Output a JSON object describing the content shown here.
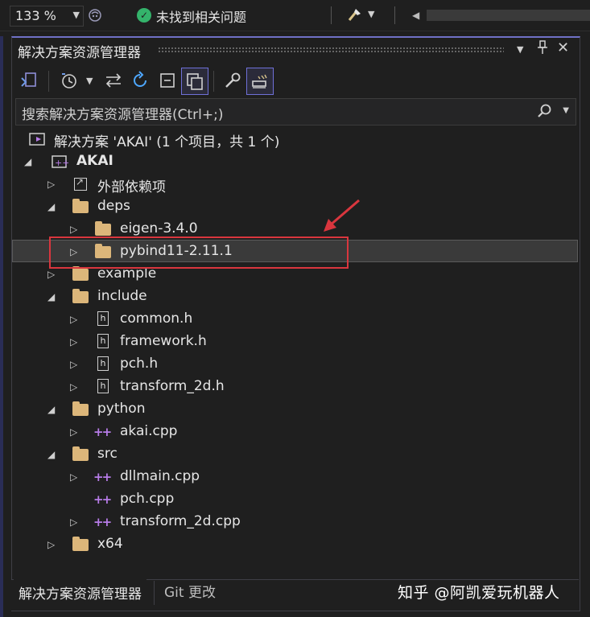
{
  "topbar": {
    "zoom": "133 %",
    "status": "未找到相关问题"
  },
  "panel": {
    "title": "解决方案资源管理器"
  },
  "search": {
    "placeholder": "搜索解决方案资源管理器(Ctrl+;)"
  },
  "tree": {
    "solution": "解决方案 'AKAI' (1 个项目，共 1 个)",
    "project": "AKAI",
    "external_deps": "外部依赖项",
    "deps": "deps",
    "eigen": "eigen-3.4.0",
    "pybind": "pybind11-2.11.1",
    "example": "example",
    "include": "include",
    "common_h": "common.h",
    "framework_h": "framework.h",
    "pch_h": "pch.h",
    "transform_2d_h": "transform_2d.h",
    "python": "python",
    "akai_cpp": "akai.cpp",
    "src": "src",
    "dllmain_cpp": "dllmain.cpp",
    "pch_cpp": "pch.cpp",
    "transform_2d_cpp": "transform_2d.cpp",
    "x64": "x64"
  },
  "tabs": {
    "solution_explorer": "解决方案资源管理器",
    "git_changes": "Git 更改"
  },
  "watermark": "知乎 @阿凯爱玩机器人",
  "colors": {
    "accent": "#7071c7",
    "folder": "#dcb67a",
    "cpp_icon": "#b77ce8",
    "annotation": "#d9363e",
    "status_ok": "#34b36b"
  }
}
